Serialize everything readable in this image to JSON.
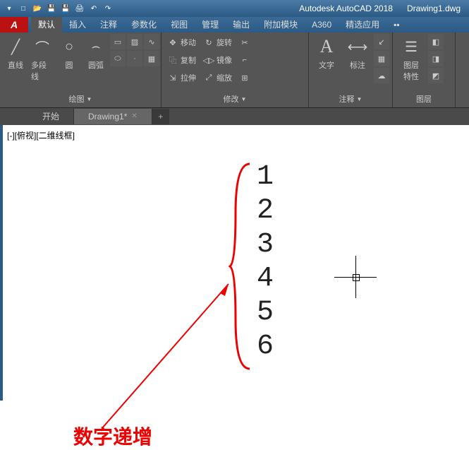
{
  "title": {
    "product": "Autodesk AutoCAD 2018",
    "file": "Drawing1.dwg"
  },
  "app_button": "A",
  "tabs": [
    "默认",
    "插入",
    "注释",
    "参数化",
    "视图",
    "管理",
    "输出",
    "附加模块",
    "A360",
    "精选应用"
  ],
  "panels": {
    "draw": {
      "title": "绘图",
      "buttons": {
        "line": "直线",
        "polyline": "多段线",
        "circle": "圆",
        "arc": "圆弧"
      }
    },
    "modify": {
      "title": "修改",
      "move": "移动",
      "rotate": "旋转",
      "copy": "复制",
      "mirror": "镜像",
      "stretch": "拉伸",
      "scale": "缩放"
    },
    "annotate": {
      "title": "注释",
      "text": "文字",
      "dim": "标注"
    },
    "layer": {
      "title": "图层",
      "props": "图层\n特性"
    },
    "block": {
      "title": "图层"
    }
  },
  "doc_tabs": [
    {
      "label": "开始",
      "active": false
    },
    {
      "label": "Drawing1*",
      "active": true
    }
  ],
  "plus": "+",
  "view_label": "[-][俯视][二维线框]",
  "numbers": [
    "1",
    "2",
    "3",
    "4",
    "5",
    "6"
  ],
  "annotation": "数字递增"
}
